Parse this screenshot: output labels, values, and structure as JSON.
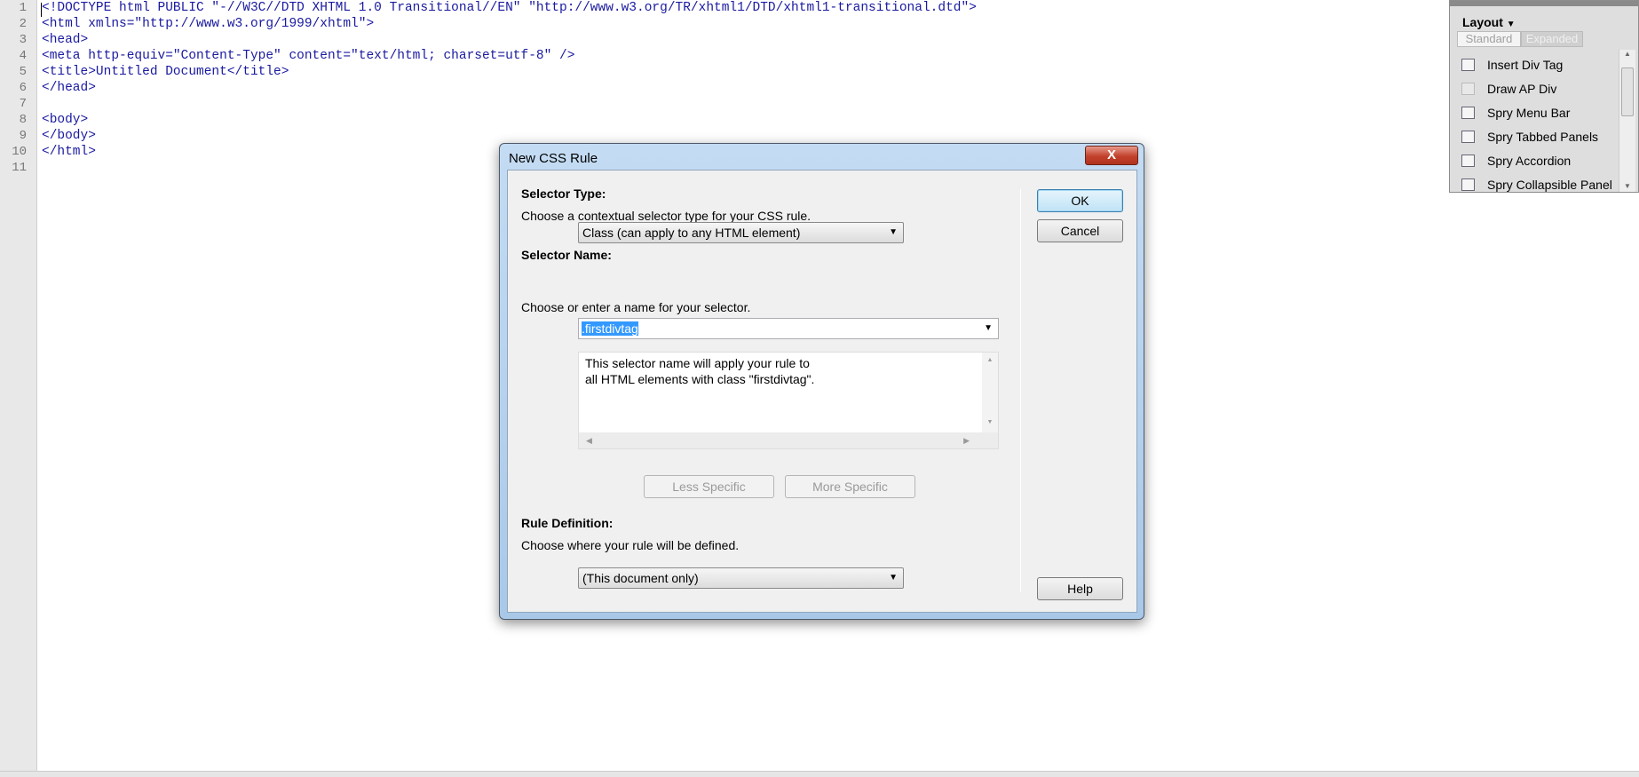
{
  "editor": {
    "lines": [
      "<!DOCTYPE html PUBLIC \"-//W3C//DTD XHTML 1.0 Transitional//EN\" \"http://www.w3.org/TR/xhtml1/DTD/xhtml1-transitional.dtd\">",
      "<html xmlns=\"http://www.w3.org/1999/xhtml\">",
      "<head>",
      "<meta http-equiv=\"Content-Type\" content=\"text/html; charset=utf-8\" />",
      "<title>Untitled Document</title>",
      "</head>",
      "",
      "<body>",
      "</body>",
      "</html>",
      ""
    ],
    "line_numbers": [
      "1",
      "2",
      "3",
      "4",
      "5",
      "6",
      "7",
      "8",
      "9",
      "10",
      "11"
    ]
  },
  "insert_panel": {
    "category": "Layout",
    "tabs": [
      "Standard",
      "Expanded"
    ],
    "items": [
      {
        "label": "Insert Div Tag",
        "icon": "div-tag-icon"
      },
      {
        "label": "Draw AP Div",
        "icon": "ap-div-icon"
      },
      {
        "label": "Spry Menu Bar",
        "icon": "spry-menu-bar-icon"
      },
      {
        "label": "Spry Tabbed Panels",
        "icon": "spry-tabbed-panels-icon"
      },
      {
        "label": "Spry Accordion",
        "icon": "spry-accordion-icon"
      },
      {
        "label": "Spry Collapsible Panel",
        "icon": "spry-collapsible-panel-icon"
      }
    ]
  },
  "dialog": {
    "title": "New CSS Rule",
    "close": "X",
    "selector_type": {
      "heading": "Selector Type:",
      "desc": "Choose a contextual selector type for your CSS rule.",
      "value": "Class (can apply to any HTML element)"
    },
    "selector_name": {
      "heading": "Selector Name:",
      "desc": "Choose or enter a name for your selector.",
      "value": ".firstdivtag",
      "info_line1": "This selector name will apply your rule to",
      "info_line2": "all HTML elements with class \"firstdivtag\"."
    },
    "less_specific": "Less Specific",
    "more_specific": "More Specific",
    "rule_definition": {
      "heading": "Rule Definition:",
      "desc": "Choose where your rule will be defined.",
      "value": "(This document only)"
    },
    "ok": "OK",
    "cancel": "Cancel",
    "help": "Help"
  }
}
